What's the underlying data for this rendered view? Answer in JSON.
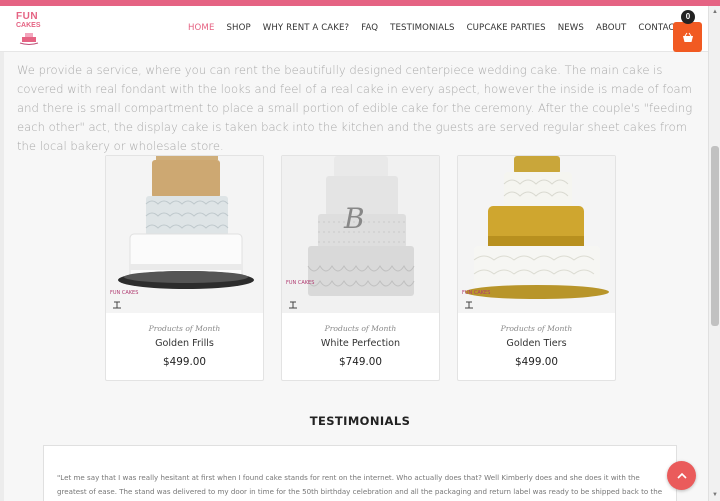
{
  "brand": {
    "logo_line1": "FUN",
    "logo_line2": "CAKES"
  },
  "nav": {
    "items": [
      {
        "label": "HOME",
        "active": true
      },
      {
        "label": "SHOP"
      },
      {
        "label": "WHY RENT A CAKE?"
      },
      {
        "label": "FAQ"
      },
      {
        "label": "TESTIMONIALS"
      },
      {
        "label": "CUPCAKE PARTIES"
      },
      {
        "label": "NEWS"
      },
      {
        "label": "ABOUT"
      },
      {
        "label": "CONTACT"
      }
    ],
    "cart_count": "0"
  },
  "intro": {
    "text": "We provide a service, where you can rent the beautifully designed centerpiece wedding cake. The main cake is covered with real fondant with the looks and feel of a real cake in every aspect, however the inside is made of foam and there is small compartment to place a small portion of edible cake for the ceremony. After the couple's \"feeding each other\" act, the display cake is taken back into the kitchen and the guests are served regular sheet cakes from the local bakery or wholesale store."
  },
  "products": [
    {
      "category": "Products of Month",
      "name": "Golden Frills",
      "price": "$499.00"
    },
    {
      "category": "Products of Month",
      "name": "White Perfection",
      "price": "$749.00"
    },
    {
      "category": "Products of Month",
      "name": "Golden Tiers",
      "price": "$499.00"
    }
  ],
  "testimonials": {
    "title": "TESTIMONIALS",
    "quote": "\"Let me say that I was really hesitant at first when I found cake stands for rent on the internet. Who actually does that? Well Kimberly does and she does it with the greatest of ease. The stand was delivered to my door in time for the 50th birthday celebration and all the packaging and return label was ready to be shipped back to the vendor with"
  },
  "colors": {
    "accent": "#e56383",
    "cart": "#f15a22",
    "to_top": "#ea5b5b"
  }
}
